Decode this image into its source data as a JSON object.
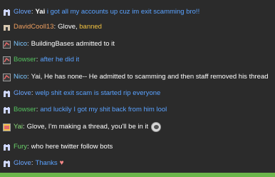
{
  "colors": {
    "background": "#2b2b2b",
    "text": "#e6e6e6",
    "name_glove": "#6aa5ff",
    "name_david": "#f0a060",
    "name_nico": "#7cc6ff",
    "name_bowser": "#54c25f",
    "name_yai": "#8ee07b",
    "name_fury": "#6ad36a",
    "mention_blue": "#5aa2ff",
    "bottom_bar": "#6bb64a"
  },
  "messages": [
    {
      "icon": "castle-icon",
      "name": "Glove",
      "text_prefix": "Yai",
      "text": " i got all my accounts up cuz im exit scamming bro!!"
    },
    {
      "icon": "castle-icon",
      "name": "DavidCooll13",
      "text": "Glove, ",
      "text_suffix": "banned"
    },
    {
      "icon": "nico-icon",
      "name": "Nico",
      "text": "BuildingBases admitted to it"
    },
    {
      "icon": "nico-icon",
      "name": "Bowser",
      "text": "after he did it"
    },
    {
      "icon": "nico-icon",
      "name": "Nico",
      "text": "Yai, He has none-- He admitted to scamming and then staff removed his thread"
    },
    {
      "icon": "castle-icon",
      "name": "Glove",
      "text": "welp shit exit scam is started rip everyone"
    },
    {
      "icon": "castle-icon",
      "name": "Bowser",
      "text": "and luckily I got my shit back from him lool"
    },
    {
      "icon": "yai-icon",
      "name": "Yai",
      "text": "Glove, I'm making a thread, you'll be in it"
    },
    {
      "icon": "castle-icon",
      "name": "Fury",
      "text": "who here twitter follow bots"
    },
    {
      "icon": "castle-icon",
      "name": "Glove",
      "text": "Thanks"
    }
  ]
}
